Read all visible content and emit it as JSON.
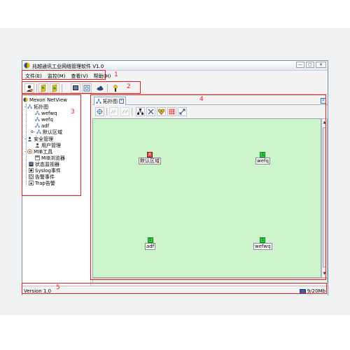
{
  "window": {
    "title": "兆越通讯工业网络管理软件 V1.0",
    "buttons": [
      "—",
      "▢",
      "✕"
    ]
  },
  "menu": [
    {
      "label": "文件(E)"
    },
    {
      "label": "监控(M)"
    },
    {
      "label": "查看(V)"
    },
    {
      "label": "帮助(H)"
    }
  ],
  "toolbar": {
    "buttons": [
      "user-icon",
      "device-add-icon",
      "device-ok-icon",
      "monitor-icon",
      "search-icon",
      "cloud-icon",
      "help-icon"
    ]
  },
  "tree": {
    "root": "Mexon NetView",
    "topology": "拓扑图",
    "topology_children": [
      "wefwq",
      "wefq",
      "adf",
      "默认区域"
    ],
    "security": "安全管理",
    "security_children": [
      "用户管理"
    ],
    "mib": "MIB工具",
    "mib_children": [
      "MIB浏览器"
    ],
    "status_monitor": "状态监视器",
    "syslog": "Syslog事件",
    "alarm_event": "告警事件",
    "trap": "Trap告警"
  },
  "tab": {
    "label": "拓扑图"
  },
  "canvas_toolbar": {
    "buttons": [
      "select-icon",
      "link-icon",
      "unlink-icon",
      "network-icon",
      "disconnect-icon",
      "heart-icon",
      "grid-icon",
      "zoom-fit-icon"
    ]
  },
  "nodes": [
    {
      "label": "默认区域",
      "badge": "X",
      "color": "red"
    },
    {
      "label": "wefq",
      "badge": "1",
      "color": "green"
    },
    {
      "label": "adf",
      "badge": "1",
      "color": "green"
    },
    {
      "label": "wefwq",
      "badge": "1",
      "color": "green"
    }
  ],
  "status": {
    "version": "Version 1.0",
    "memory": "9/20Mb"
  },
  "annotations": [
    "1",
    "2",
    "3",
    "4",
    "5"
  ],
  "colors": {
    "canvas": "#ccf5cc",
    "annotation": "#e02020",
    "node_green": "#2ecc40",
    "node_red": "#e84a4a"
  }
}
